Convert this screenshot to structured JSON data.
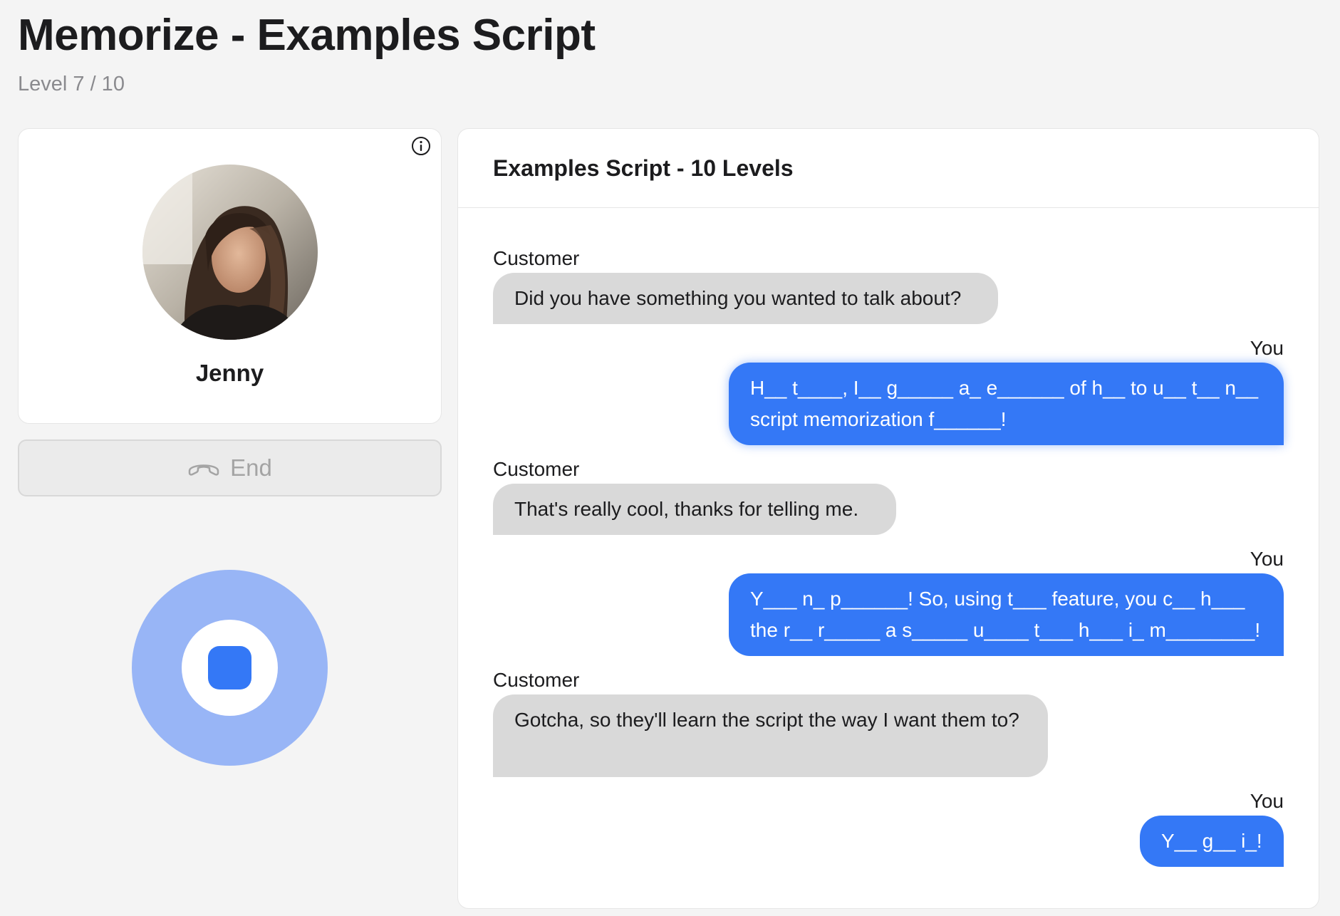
{
  "page": {
    "title": "Memorize - Examples Script",
    "level_text": "Level 7 / 10"
  },
  "caller": {
    "name": "Jenny",
    "info_icon": "info-icon",
    "avatar": "profile-photo"
  },
  "end_button": {
    "label": "End",
    "icon": "phone-hangup-icon"
  },
  "record_control": {
    "icon": "stop-icon",
    "state": "recording"
  },
  "script_panel": {
    "title": "Examples Script - 10 Levels",
    "messages": [
      {
        "sender": "Customer",
        "text": "Did you have something you wanted to talk about?"
      },
      {
        "sender": "You",
        "text": "H__ t____, I__ g_____ a_ e______ of h__ to u__ t__ n__ script memorization f______!"
      },
      {
        "sender": "Customer",
        "text": "That's really cool, thanks for telling me."
      },
      {
        "sender": "You",
        "text": "Y___ n_ p______! So, using t___ feature, you c__ h___ the r__ r_____ a s_____ u____ t___ h___ i_ m________!"
      },
      {
        "sender": "Customer",
        "text": "Gotcha, so they'll learn the script the way I want them to?"
      },
      {
        "sender": "You",
        "text": "Y__ g__ i_!"
      }
    ]
  },
  "colors": {
    "accent": "#3478f6",
    "accent_light": "#98b5f6",
    "customer_bubble": "#d9d9d9",
    "background": "#f4f4f4"
  }
}
